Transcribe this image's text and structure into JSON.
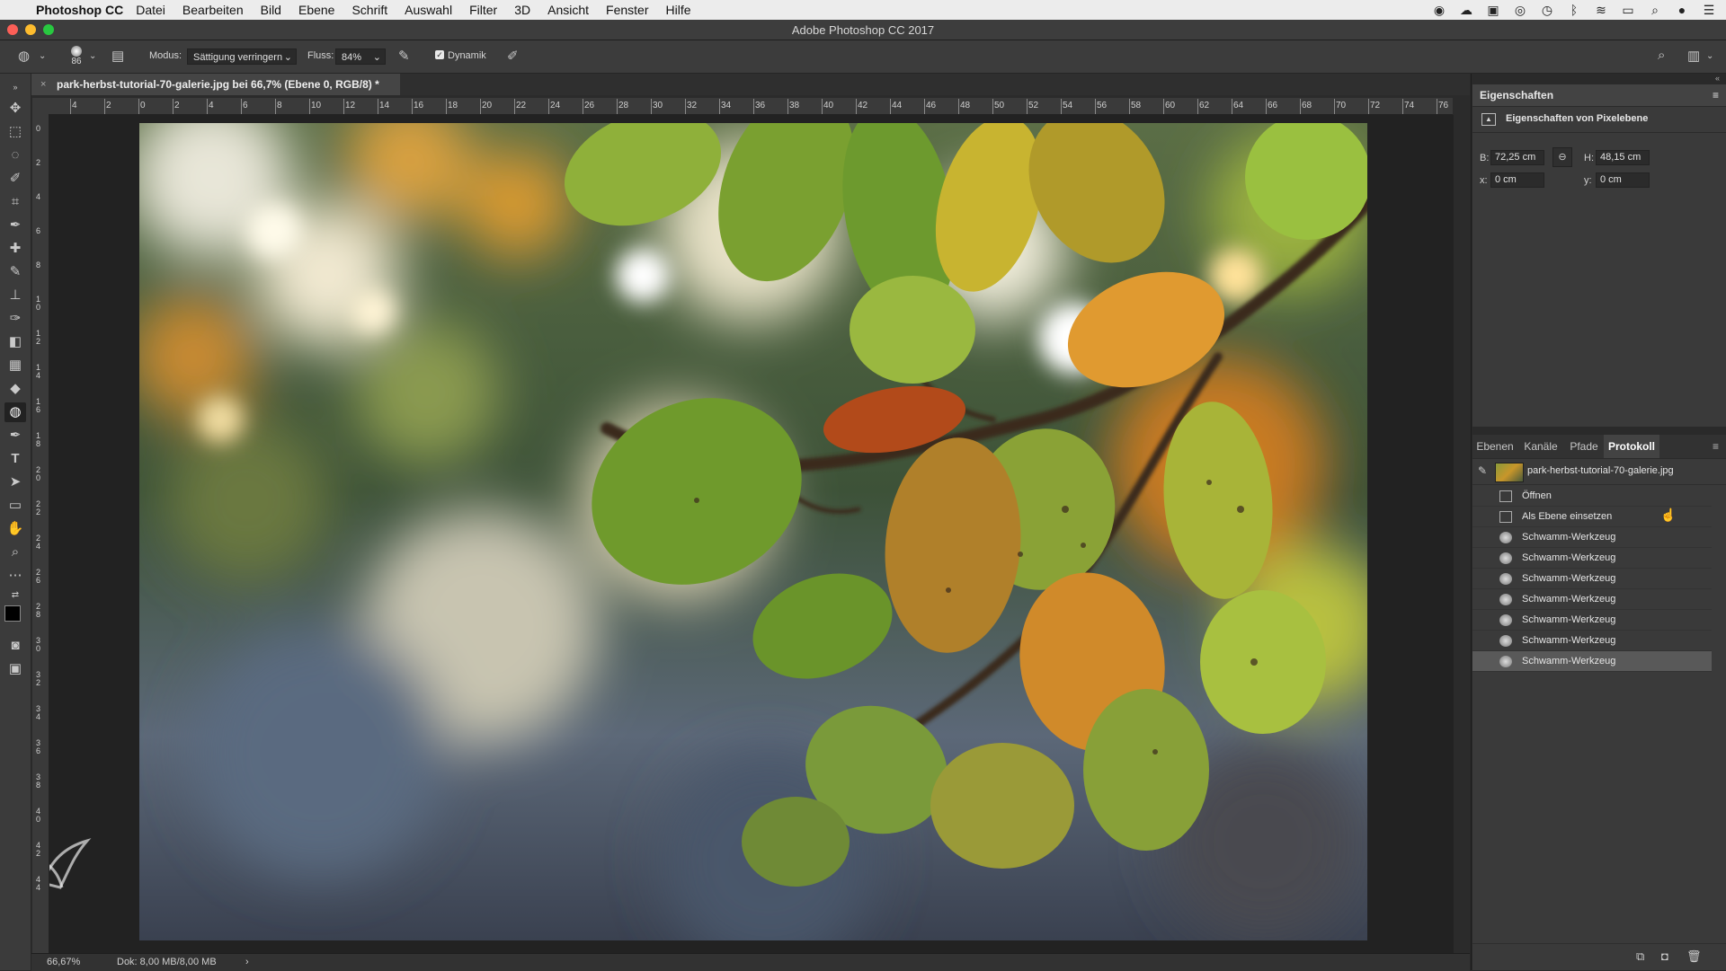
{
  "menubar": {
    "app_name": "Photoshop CC",
    "items": [
      "Datei",
      "Bearbeiten",
      "Bild",
      "Ebene",
      "Schrift",
      "Auswahl",
      "Filter",
      "3D",
      "Ansicht",
      "Fenster",
      "Hilfe"
    ]
  },
  "window": {
    "title": "Adobe Photoshop CC 2017"
  },
  "options": {
    "brush_size": "86",
    "mode_label": "Modus:",
    "mode_value": "Sättigung verringern",
    "flow_label": "Fluss:",
    "flow_value": "84%",
    "vibrance_label": "Dynamik"
  },
  "document": {
    "tab_title": "park-herbst-tutorial-70-galerie.jpg bei 66,7% (Ebene 0, RGB/8) *",
    "h_ruler_labels": [
      "4",
      "2",
      "0",
      "2",
      "4",
      "6",
      "8",
      "10",
      "12",
      "14",
      "16",
      "18",
      "20",
      "22",
      "24",
      "26",
      "28",
      "30",
      "32",
      "34",
      "36",
      "38",
      "40",
      "42",
      "44",
      "46",
      "48",
      "50",
      "52",
      "54",
      "56",
      "58",
      "60",
      "62",
      "64",
      "66",
      "68",
      "70",
      "72",
      "74",
      "76"
    ],
    "v_ruler_labels": [
      "0",
      "2",
      "4",
      "6",
      "8",
      "10",
      "12",
      "14",
      "16",
      "18",
      "20",
      "22",
      "24",
      "26",
      "28",
      "30",
      "32",
      "34",
      "36",
      "38",
      "40",
      "42",
      "44"
    ]
  },
  "status": {
    "zoom": "66,67%",
    "doc_size": "Dok: 8,00 MB/8,00 MB",
    "arrow": "›"
  },
  "properties": {
    "title": "Eigenschaften",
    "subtitle": "Eigenschaften von Pixelebene",
    "w_label": "B:",
    "w_value": "72,25 cm",
    "h_label": "H:",
    "h_value": "48,15 cm",
    "x_label": "x:",
    "x_value": "0 cm",
    "y_label": "y:",
    "y_value": "0 cm"
  },
  "panel_tabs": [
    "Ebenen",
    "Kanäle",
    "Pfade",
    "Protokoll"
  ],
  "active_tab": "Protokoll",
  "history": {
    "snapshot_name": "park-herbst-tutorial-70-galerie.jpg",
    "items": [
      {
        "label": "Öffnen",
        "icon": "document-icon"
      },
      {
        "label": "Als Ebene einsetzen",
        "icon": "document-icon"
      },
      {
        "label": "Schwamm-Werkzeug",
        "icon": "sponge-icon"
      },
      {
        "label": "Schwamm-Werkzeug",
        "icon": "sponge-icon"
      },
      {
        "label": "Schwamm-Werkzeug",
        "icon": "sponge-icon"
      },
      {
        "label": "Schwamm-Werkzeug",
        "icon": "sponge-icon"
      },
      {
        "label": "Schwamm-Werkzeug",
        "icon": "sponge-icon"
      },
      {
        "label": "Schwamm-Werkzeug",
        "icon": "sponge-icon"
      },
      {
        "label": "Schwamm-Werkzeug",
        "icon": "sponge-icon"
      }
    ],
    "selected_index": 8
  },
  "colors": {
    "menubar_bg": "#ececec",
    "panel_bg": "#3a3a3a",
    "selected_row": "#595959",
    "canvas_bg": "#222222"
  }
}
